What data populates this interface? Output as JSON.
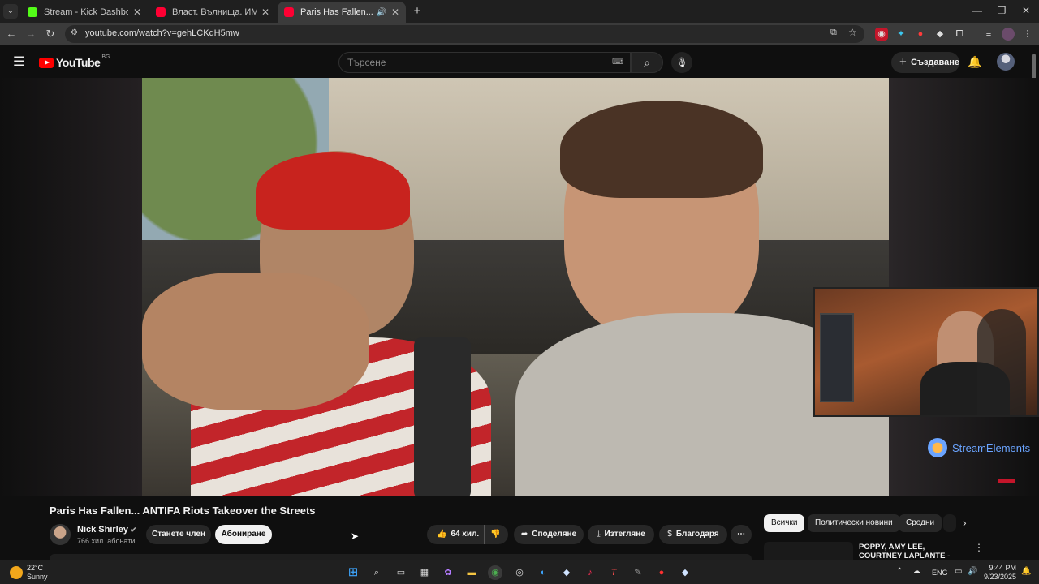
{
  "browser": {
    "tabs": [
      {
        "title": "Stream - Kick Dashboard",
        "favicon_color": "#53fc18",
        "active": false
      },
      {
        "title": "Власт. Вълнища. ИМПЕРИЯ. И",
        "favicon_color": "#ff0033",
        "active": false
      },
      {
        "title": "Paris Has Fallen... ANTIFA R",
        "favicon_color": "#ff0033",
        "active": true
      }
    ],
    "url": "youtube.com/watch?v=gehLCKdH5mw"
  },
  "youtube": {
    "logo_text": "YouTube",
    "country_code": "BG",
    "search_placeholder": "Търсене",
    "create_label": "Създаване"
  },
  "video": {
    "title": "Paris Has Fallen... ANTIFA Riots Takeover the Streets",
    "channel_name": "Nick Shirley",
    "subscribers": "766 хил. абонати",
    "join_label": "Станете член",
    "subscribe_label": "Абониране",
    "likes": "64 хил.",
    "share_label": "Споделяне",
    "download_label": "Изтегляне",
    "thanks_label": "Благодаря"
  },
  "overlay": {
    "brand": "StreamElements"
  },
  "sidebar": {
    "chips": [
      "Всички",
      "Политически новини",
      "Сродни"
    ],
    "recommendation_title": "POPPY, AMY LEE, COURTNEY LAPLANTE - End of You (Offici"
  },
  "taskbar": {
    "weather_temp": "22°C",
    "weather_desc": "Sunny",
    "lang": "ENG",
    "time": "9:44 PM",
    "date": "9/23/2025"
  },
  "colors": {
    "yt_red": "#ff0000",
    "background": "#0f0f0f",
    "kick_green": "#53fc18",
    "se_blue": "#6aa4ff"
  }
}
